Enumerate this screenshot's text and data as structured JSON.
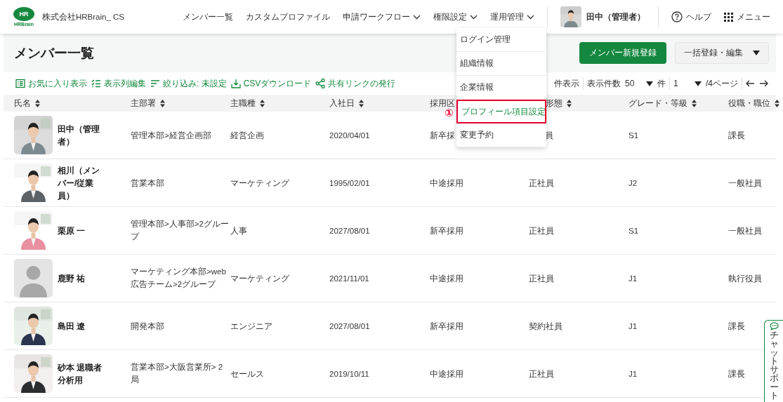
{
  "header": {
    "logo": {
      "mark": "HR",
      "wordmark": "HRBrain"
    },
    "company": "株式会社HRBrain_ CS",
    "nav": [
      {
        "label": "メンバー一覧",
        "has_menu": false
      },
      {
        "label": "カスタムプロファイル",
        "has_menu": false
      },
      {
        "label": "申請ワークフロー",
        "has_menu": true
      },
      {
        "label": "権限設定",
        "has_menu": true
      },
      {
        "label": "運用管理",
        "has_menu": true
      }
    ],
    "user": {
      "name": "田中（管理者）"
    },
    "help": "ヘルプ",
    "menu": "メニュー"
  },
  "dropdown": {
    "items": [
      {
        "label": "ログイン管理",
        "highlighted": false
      },
      {
        "label": "組織情報",
        "highlighted": false
      },
      {
        "label": "企業情報",
        "highlighted": false
      },
      {
        "label": "プロフィール項目設定",
        "highlighted": true
      },
      {
        "label": "変更予約",
        "highlighted": false
      }
    ],
    "annotation": "①"
  },
  "page": {
    "title": "メンバー一覧",
    "primary_button": "メンバー新規登録",
    "secondary_button": "一括登録・編集"
  },
  "toolbar": {
    "actions": [
      {
        "label": "お気に入り表示"
      },
      {
        "label": "表示列編集"
      },
      {
        "label": "絞り込み: 未設定"
      },
      {
        "label": "CSVダウンロード"
      },
      {
        "label": "共有リンクの発行"
      }
    ],
    "range": "件表示",
    "page_size": {
      "label": "表示件数",
      "value": "50",
      "unit": "件"
    },
    "pagination": {
      "value": "1",
      "suffix": "/4ページ"
    }
  },
  "table": {
    "columns": [
      {
        "label": "氏名",
        "partial": false
      },
      {
        "label": "主部署",
        "partial": false
      },
      {
        "label": "主職種",
        "partial": false
      },
      {
        "label": "入社日",
        "partial": false
      },
      {
        "label": "採用区",
        "partial": false
      },
      {
        "label": "形態",
        "partial": true
      },
      {
        "label": "グレード・等級",
        "partial": false
      },
      {
        "label": "役職・職位",
        "partial": false
      }
    ],
    "rows": [
      {
        "cells": [
          "田中（管理者）",
          "管理本部>経営企画部",
          "経営企画",
          "2020/04/01",
          "新卒採",
          {
            "text": "員",
            "partial": true
          },
          "S1",
          "課長"
        ]
      },
      {
        "cells": [
          "相川（メンバー/従業員）",
          "営業本部",
          "マーケティング",
          "1995/02/01",
          "中途採用",
          "正社員",
          "J2",
          "一般社員"
        ]
      },
      {
        "cells": [
          "栗原 一",
          "管理本部>人事部>2グループ",
          "人事",
          "2027/08/01",
          "新卒採用",
          "正社員",
          "S1",
          "一般社員"
        ]
      },
      {
        "kind": "placeholder",
        "cells": [
          "鹿野 祐",
          "マーケティング本部>web広告チーム>2グループ",
          "マーケティング",
          "2021/11/01",
          "中途採用",
          "正社員",
          "J1",
          "執行役員"
        ]
      },
      {
        "cells": [
          "島田 遼",
          "開発本部",
          "エンジニア",
          "2027/08/01",
          "新卒採用",
          "契約社員",
          "J1",
          "課長"
        ]
      },
      {
        "cells": [
          "砂本 退職者分析用",
          "営業本部>大阪営業所> 2局",
          "セールス",
          "2019/10/11",
          "中途採用",
          "正社員",
          "J1",
          "課長"
        ]
      }
    ]
  },
  "chat_support": {
    "label": "チャットサポート"
  }
}
